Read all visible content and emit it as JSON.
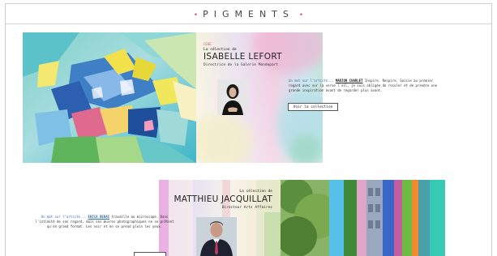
{
  "header": {
    "logo": "PIGMENTS",
    "dot": "•"
  },
  "feature1": {
    "small_label": "CEHE",
    "selection_label": "La sélection de",
    "name": "ISABELLE LEFORT",
    "role": "Directrice de la Galerie Mondepart",
    "bio_lead": "Un mot sur l'artiste...",
    "bio_artist": "MARION CHARLET",
    "bio_text": " Inspire. Respire. Saisie au premier regard avec sur la verve l'oil, je suis obligée de reculer et de prendre une grande inspiration avant de regarder plus avant.",
    "button": "Voir la collection"
  },
  "feature2": {
    "selection_label": "La sélection de",
    "name": "MATTHIEU JACQUILLAT",
    "role": "Directeur Arts Affaires",
    "bio_lead": "Un mot sur l'artiste...",
    "bio_artist": "ERICA BERAC",
    "bio_text": " travaille au microscope. Dans l'intimité de son regard, mais ses œuvres photographiques ne se prêtent qu'en grand format. Les voir et en se prend plein les yeux."
  },
  "colors": {
    "accent_pink": "#d95b8a",
    "link_blue": "#2f6fb2"
  }
}
